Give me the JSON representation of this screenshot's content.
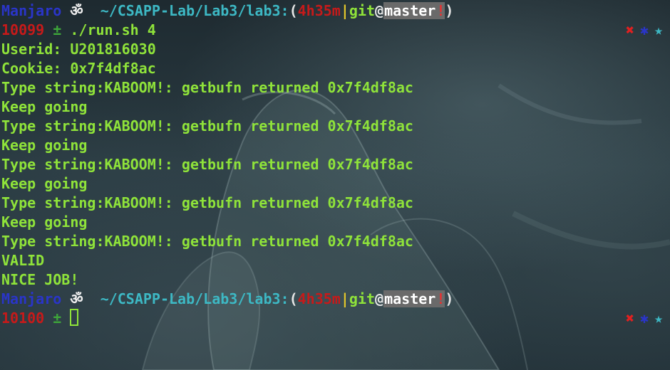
{
  "prompts": [
    {
      "user": "Manjaro",
      "symbol": "ॐ",
      "path": "~/CSAPP-Lab/Lab3/lab3:",
      "paren_open": "(",
      "duration": "4h35m",
      "pipe": "|",
      "git": "git",
      "at": "@",
      "branch": "master",
      "dirty": "!",
      "paren_close": ")",
      "history": "10099",
      "plusminus": "±",
      "command": "./run.sh 4"
    },
    {
      "user": "Manjaro",
      "symbol": "ॐ",
      "path": "~/CSAPP-Lab/Lab3/lab3:",
      "paren_open": "(",
      "duration": "4h35m",
      "pipe": "|",
      "git": "git",
      "at": "@",
      "branch": "master",
      "dirty": "!",
      "paren_close": ")",
      "history": "10100",
      "plusminus": "±",
      "command": ""
    }
  ],
  "output": [
    "Userid: U201816030",
    "Cookie: 0x7f4df8ac",
    "Type string:KABOOM!: getbufn returned 0x7f4df8ac",
    "Keep going",
    "Type string:KABOOM!: getbufn returned 0x7f4df8ac",
    "Keep going",
    "Type string:KABOOM!: getbufn returned 0x7f4df8ac",
    "Keep going",
    "Type string:KABOOM!: getbufn returned 0x7f4df8ac",
    "Keep going",
    "Type string:KABOOM!: getbufn returned 0x7f4df8ac",
    "VALID",
    "NICE JOB!"
  ],
  "status_icons": {
    "error": "✖",
    "gear": "✱",
    "star": "★",
    "error_icon": "close-x-icon",
    "gear_icon": "gear-icon",
    "star_icon": "star-icon"
  },
  "colors": {
    "user": "#2a35c8",
    "path": "#3db8c4",
    "duration": "#c61a1a",
    "output": "#8fe33a",
    "branch_bg": "#6a6a6a"
  }
}
